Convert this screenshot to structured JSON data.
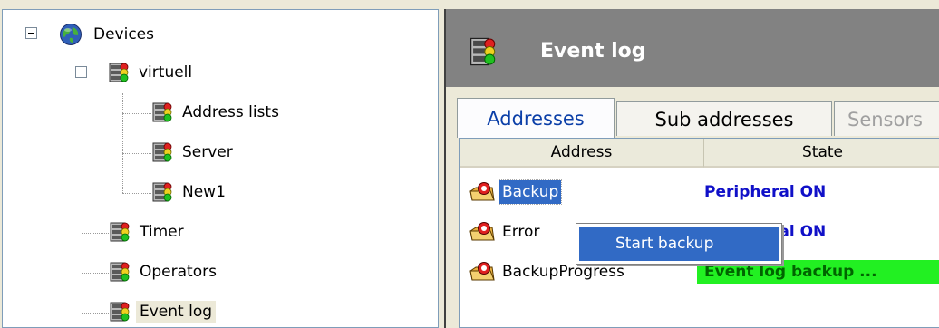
{
  "tree": {
    "nodes": [
      {
        "label": "Devices"
      },
      {
        "label": "virtuell"
      },
      {
        "label": "Address lists"
      },
      {
        "label": "Server"
      },
      {
        "label": "New1"
      },
      {
        "label": "Timer"
      },
      {
        "label": "Operators"
      },
      {
        "label": "Event log"
      }
    ]
  },
  "panel": {
    "title": "Event log"
  },
  "tabs": [
    {
      "label": "Addresses"
    },
    {
      "label": "Sub addresses"
    },
    {
      "label": "Sensors"
    }
  ],
  "list": {
    "columns": [
      "Address",
      "State"
    ],
    "rows": [
      {
        "address": "Backup",
        "state": "Peripheral ON"
      },
      {
        "address": "Error",
        "state": "Peripheral ON"
      },
      {
        "address": "BackupProgress",
        "state": "Event log backup ..."
      }
    ]
  },
  "context_menu": {
    "items": [
      {
        "label": "Start backup"
      }
    ]
  },
  "colors": {
    "state_blue": "#1010c8",
    "state_green_bg": "#22f022",
    "state_green_text": "#006400",
    "selection": "#316ac5",
    "header_bg": "#828282"
  },
  "icons": {
    "tree_root": "globe-icon",
    "tree_item": "server-icon",
    "list_item": "folder-alarm-icon"
  }
}
